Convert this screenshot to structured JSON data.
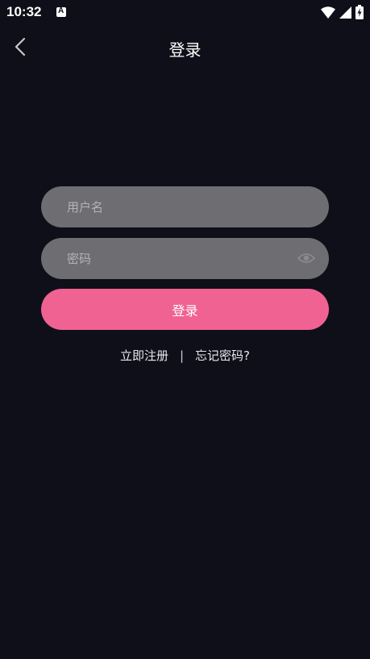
{
  "status_bar": {
    "time": "10:32",
    "notification_icon_letter": "A"
  },
  "header": {
    "title": "登录"
  },
  "form": {
    "username_placeholder": "用户名",
    "password_placeholder": "密码",
    "login_label": "登录"
  },
  "links": {
    "register": "立即注册",
    "separator": "|",
    "forgot_password": "忘记密码?"
  },
  "colors": {
    "background": "#0f0f1a",
    "field": "#6d6d72",
    "accent": "#f06292"
  }
}
